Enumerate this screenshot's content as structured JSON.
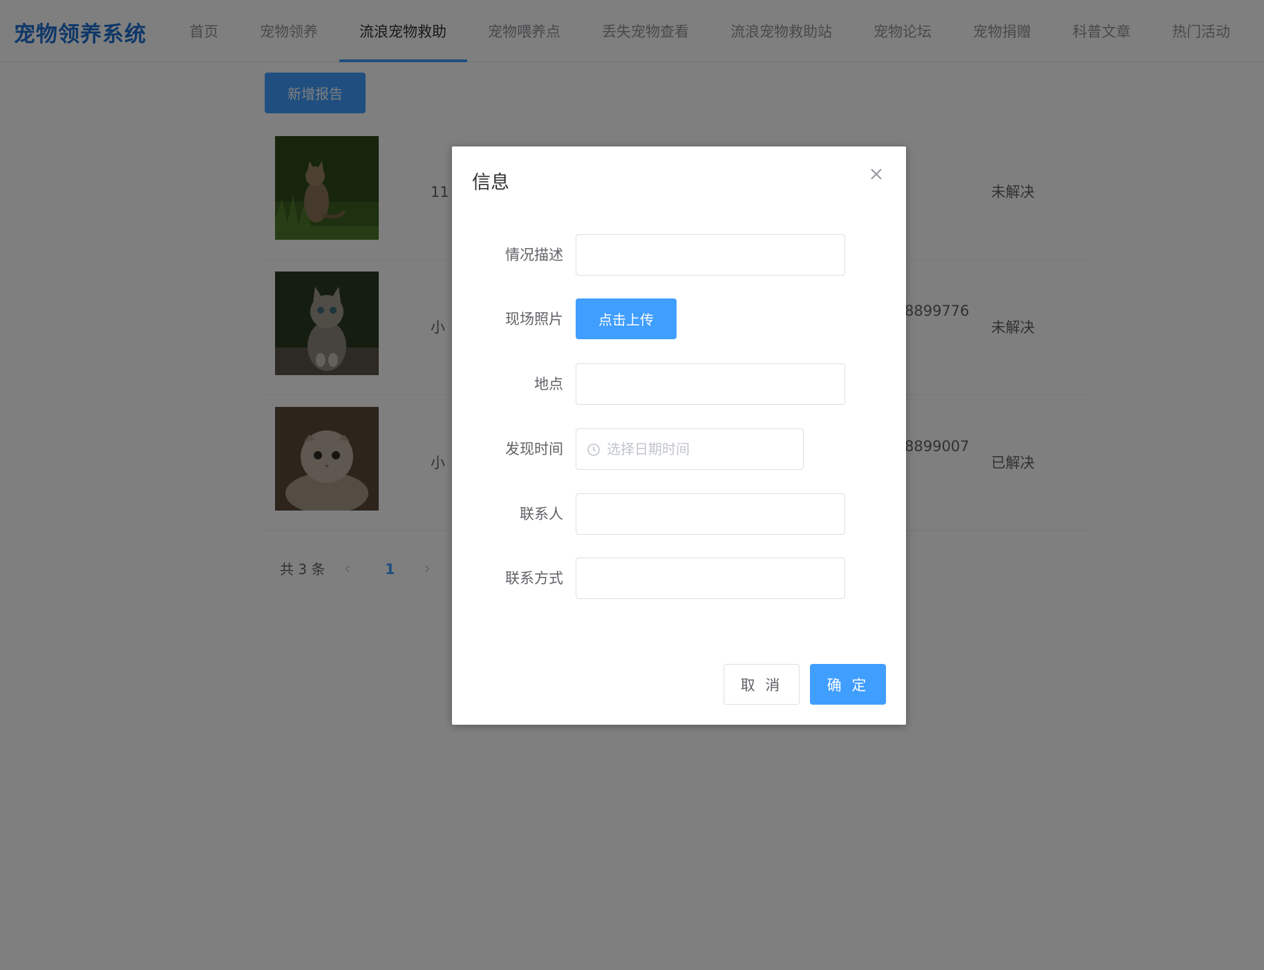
{
  "app": {
    "logo": "宠物领养系统",
    "brand_color": "#1f6fd1",
    "accent_color": "#409eff"
  },
  "nav": {
    "items": [
      "首页",
      "宠物领养",
      "流浪宠物救助",
      "宠物喂养点",
      "丢失宠物查看",
      "流浪宠物救助站",
      "宠物论坛",
      "宠物捐赠",
      "科普文章",
      "热门活动"
    ],
    "active": "流浪宠物救助"
  },
  "toolbar": {
    "add_label": "新增报告"
  },
  "reports": [
    {
      "image": "cat-in-grass",
      "description": "11",
      "phone": "",
      "status": "未解决"
    },
    {
      "image": "kitten-looking-up",
      "description": "小",
      "phone": "8899776",
      "status": "未解决"
    },
    {
      "image": "scottish-fold-cat",
      "description": "小",
      "phone": "8899007",
      "status": "已解决"
    }
  ],
  "pagination": {
    "total_label": "共 3 条",
    "current_page": "1",
    "prev_icon": "chevron-left-icon",
    "next_icon": "chevron-right-icon"
  },
  "dialog": {
    "title": "信息",
    "close_icon": "close-icon",
    "fields": {
      "description": {
        "label": "情况描述",
        "value": ""
      },
      "photo": {
        "label": "现场照片",
        "upload_label": "点击上传"
      },
      "location": {
        "label": "地点",
        "value": ""
      },
      "found_time": {
        "label": "发现时间",
        "placeholder": "选择日期时间",
        "icon": "clock-icon"
      },
      "contact": {
        "label": "联系人",
        "value": ""
      },
      "contact_method": {
        "label": "联系方式",
        "value": ""
      }
    },
    "cancel_label": "取 消",
    "confirm_label": "确 定"
  }
}
